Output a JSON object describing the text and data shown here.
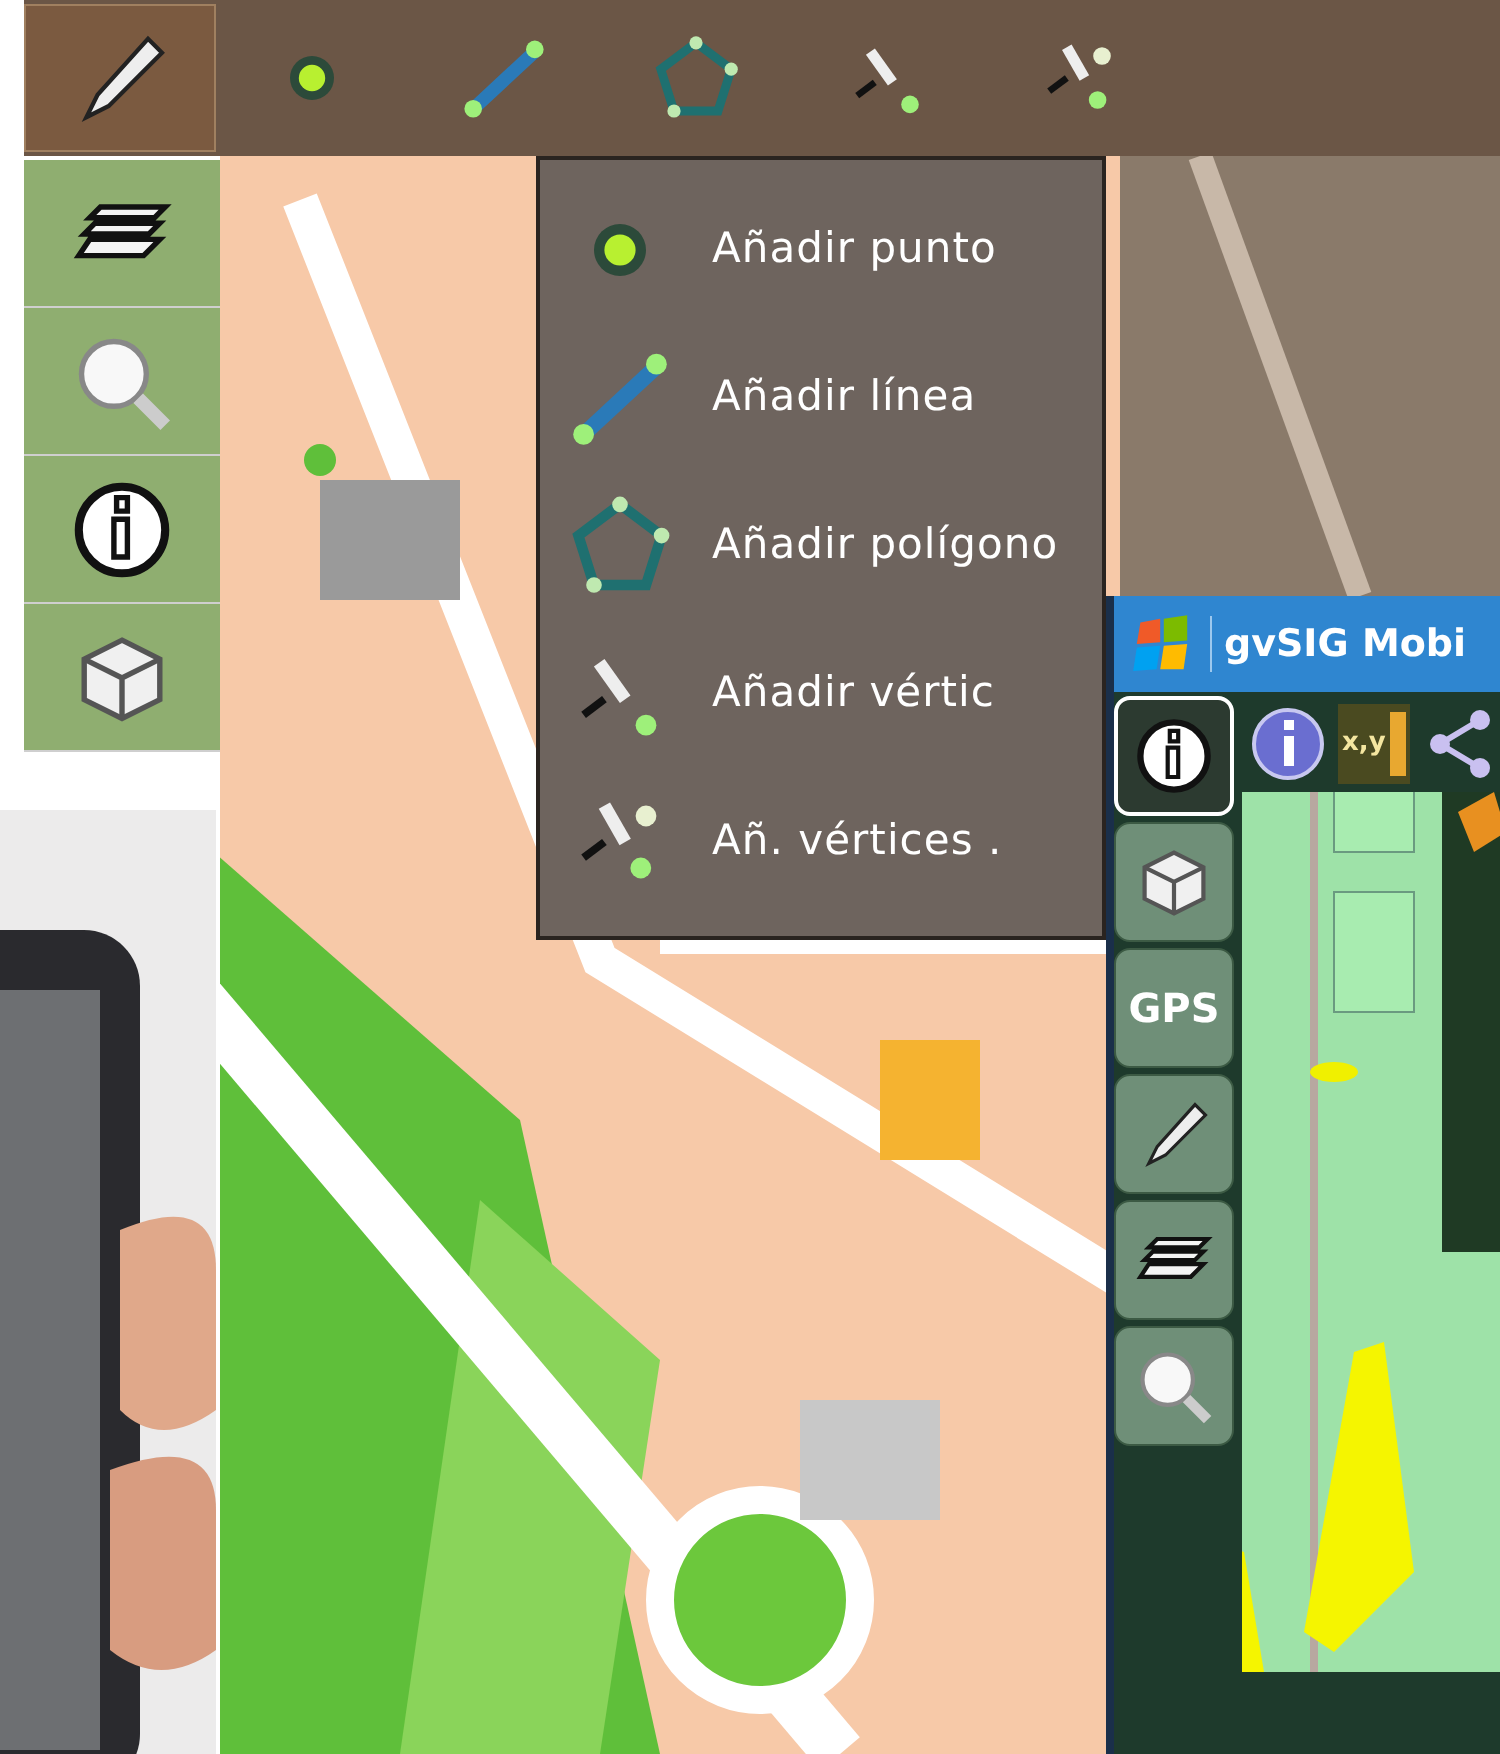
{
  "top_toolbar": {
    "tools": [
      {
        "kind": "pencil"
      },
      {
        "kind": "point"
      },
      {
        "kind": "line"
      },
      {
        "kind": "polygon"
      },
      {
        "kind": "vertex"
      },
      {
        "kind": "vertices"
      }
    ]
  },
  "left_toolbar": {
    "buttons": [
      {
        "kind": "layers"
      },
      {
        "kind": "search"
      },
      {
        "kind": "info"
      },
      {
        "kind": "box"
      }
    ]
  },
  "edit_menu": {
    "items": [
      {
        "kind": "point",
        "label": "Añadir punto"
      },
      {
        "kind": "line",
        "label": "Añadir línea"
      },
      {
        "kind": "polygon",
        "label": "Añadir polígono"
      },
      {
        "kind": "vertex",
        "label": "Añadir vértic"
      },
      {
        "kind": "vertices",
        "label": "Añ. vértices ."
      }
    ]
  },
  "inner_window": {
    "title": "gvSIG Mobi",
    "toolbar": [
      {
        "kind": "info"
      },
      {
        "kind": "coords",
        "label": "x,y"
      },
      {
        "kind": "share"
      }
    ],
    "side_buttons": [
      {
        "kind": "info",
        "selected": true
      },
      {
        "kind": "box",
        "selected": false
      },
      {
        "kind": "gps",
        "label": "GPS",
        "selected": false
      },
      {
        "kind": "pencil",
        "selected": false
      },
      {
        "kind": "layers",
        "selected": false
      },
      {
        "kind": "search",
        "selected": false
      }
    ]
  }
}
